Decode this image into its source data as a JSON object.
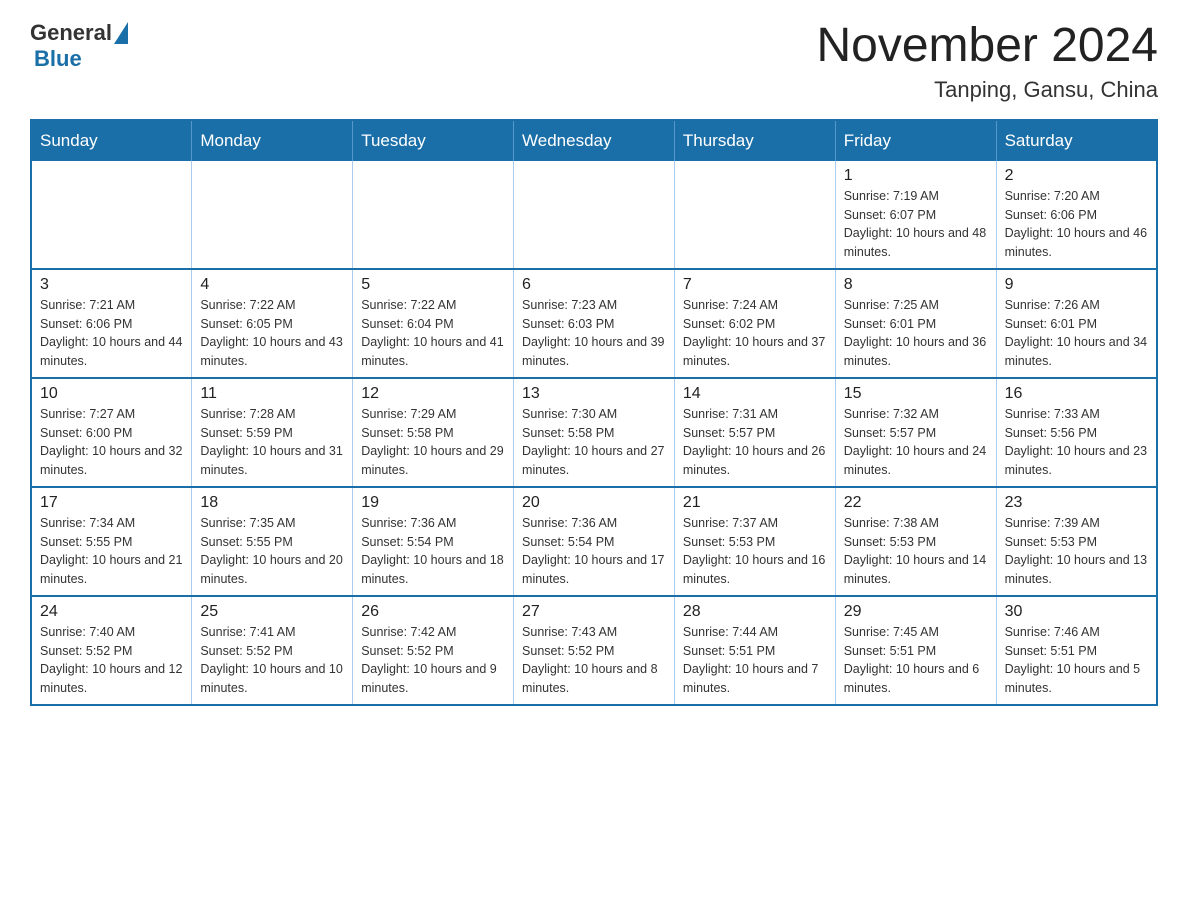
{
  "header": {
    "logo": {
      "general": "General",
      "blue": "Blue"
    },
    "title": "November 2024",
    "location": "Tanping, Gansu, China"
  },
  "weekdays": [
    "Sunday",
    "Monday",
    "Tuesday",
    "Wednesday",
    "Thursday",
    "Friday",
    "Saturday"
  ],
  "weeks": [
    [
      {
        "day": "",
        "info": ""
      },
      {
        "day": "",
        "info": ""
      },
      {
        "day": "",
        "info": ""
      },
      {
        "day": "",
        "info": ""
      },
      {
        "day": "",
        "info": ""
      },
      {
        "day": "1",
        "info": "Sunrise: 7:19 AM\nSunset: 6:07 PM\nDaylight: 10 hours and 48 minutes."
      },
      {
        "day": "2",
        "info": "Sunrise: 7:20 AM\nSunset: 6:06 PM\nDaylight: 10 hours and 46 minutes."
      }
    ],
    [
      {
        "day": "3",
        "info": "Sunrise: 7:21 AM\nSunset: 6:06 PM\nDaylight: 10 hours and 44 minutes."
      },
      {
        "day": "4",
        "info": "Sunrise: 7:22 AM\nSunset: 6:05 PM\nDaylight: 10 hours and 43 minutes."
      },
      {
        "day": "5",
        "info": "Sunrise: 7:22 AM\nSunset: 6:04 PM\nDaylight: 10 hours and 41 minutes."
      },
      {
        "day": "6",
        "info": "Sunrise: 7:23 AM\nSunset: 6:03 PM\nDaylight: 10 hours and 39 minutes."
      },
      {
        "day": "7",
        "info": "Sunrise: 7:24 AM\nSunset: 6:02 PM\nDaylight: 10 hours and 37 minutes."
      },
      {
        "day": "8",
        "info": "Sunrise: 7:25 AM\nSunset: 6:01 PM\nDaylight: 10 hours and 36 minutes."
      },
      {
        "day": "9",
        "info": "Sunrise: 7:26 AM\nSunset: 6:01 PM\nDaylight: 10 hours and 34 minutes."
      }
    ],
    [
      {
        "day": "10",
        "info": "Sunrise: 7:27 AM\nSunset: 6:00 PM\nDaylight: 10 hours and 32 minutes."
      },
      {
        "day": "11",
        "info": "Sunrise: 7:28 AM\nSunset: 5:59 PM\nDaylight: 10 hours and 31 minutes."
      },
      {
        "day": "12",
        "info": "Sunrise: 7:29 AM\nSunset: 5:58 PM\nDaylight: 10 hours and 29 minutes."
      },
      {
        "day": "13",
        "info": "Sunrise: 7:30 AM\nSunset: 5:58 PM\nDaylight: 10 hours and 27 minutes."
      },
      {
        "day": "14",
        "info": "Sunrise: 7:31 AM\nSunset: 5:57 PM\nDaylight: 10 hours and 26 minutes."
      },
      {
        "day": "15",
        "info": "Sunrise: 7:32 AM\nSunset: 5:57 PM\nDaylight: 10 hours and 24 minutes."
      },
      {
        "day": "16",
        "info": "Sunrise: 7:33 AM\nSunset: 5:56 PM\nDaylight: 10 hours and 23 minutes."
      }
    ],
    [
      {
        "day": "17",
        "info": "Sunrise: 7:34 AM\nSunset: 5:55 PM\nDaylight: 10 hours and 21 minutes."
      },
      {
        "day": "18",
        "info": "Sunrise: 7:35 AM\nSunset: 5:55 PM\nDaylight: 10 hours and 20 minutes."
      },
      {
        "day": "19",
        "info": "Sunrise: 7:36 AM\nSunset: 5:54 PM\nDaylight: 10 hours and 18 minutes."
      },
      {
        "day": "20",
        "info": "Sunrise: 7:36 AM\nSunset: 5:54 PM\nDaylight: 10 hours and 17 minutes."
      },
      {
        "day": "21",
        "info": "Sunrise: 7:37 AM\nSunset: 5:53 PM\nDaylight: 10 hours and 16 minutes."
      },
      {
        "day": "22",
        "info": "Sunrise: 7:38 AM\nSunset: 5:53 PM\nDaylight: 10 hours and 14 minutes."
      },
      {
        "day": "23",
        "info": "Sunrise: 7:39 AM\nSunset: 5:53 PM\nDaylight: 10 hours and 13 minutes."
      }
    ],
    [
      {
        "day": "24",
        "info": "Sunrise: 7:40 AM\nSunset: 5:52 PM\nDaylight: 10 hours and 12 minutes."
      },
      {
        "day": "25",
        "info": "Sunrise: 7:41 AM\nSunset: 5:52 PM\nDaylight: 10 hours and 10 minutes."
      },
      {
        "day": "26",
        "info": "Sunrise: 7:42 AM\nSunset: 5:52 PM\nDaylight: 10 hours and 9 minutes."
      },
      {
        "day": "27",
        "info": "Sunrise: 7:43 AM\nSunset: 5:52 PM\nDaylight: 10 hours and 8 minutes."
      },
      {
        "day": "28",
        "info": "Sunrise: 7:44 AM\nSunset: 5:51 PM\nDaylight: 10 hours and 7 minutes."
      },
      {
        "day": "29",
        "info": "Sunrise: 7:45 AM\nSunset: 5:51 PM\nDaylight: 10 hours and 6 minutes."
      },
      {
        "day": "30",
        "info": "Sunrise: 7:46 AM\nSunset: 5:51 PM\nDaylight: 10 hours and 5 minutes."
      }
    ]
  ]
}
